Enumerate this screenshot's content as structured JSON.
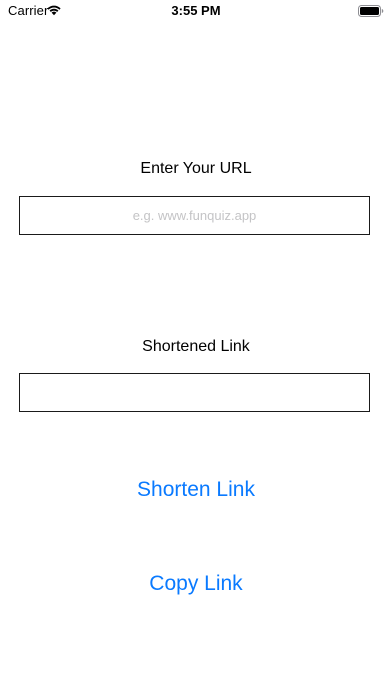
{
  "status_bar": {
    "carrier": "Carrier",
    "time": "3:55 PM",
    "wifi_icon": "wifi-icon",
    "battery_icon": "battery-icon"
  },
  "url_section": {
    "label": "Enter Your URL",
    "value": "",
    "placeholder": "e.g. www.funquiz.app"
  },
  "short_section": {
    "label": "Shortened Link",
    "value": "",
    "placeholder": ""
  },
  "buttons": {
    "shorten_label": "Shorten Link",
    "copy_label": "Copy Link"
  },
  "colors": {
    "accent": "#0a7aff",
    "placeholder": "#c4c4c6",
    "field_border": "#1a1a1a"
  }
}
